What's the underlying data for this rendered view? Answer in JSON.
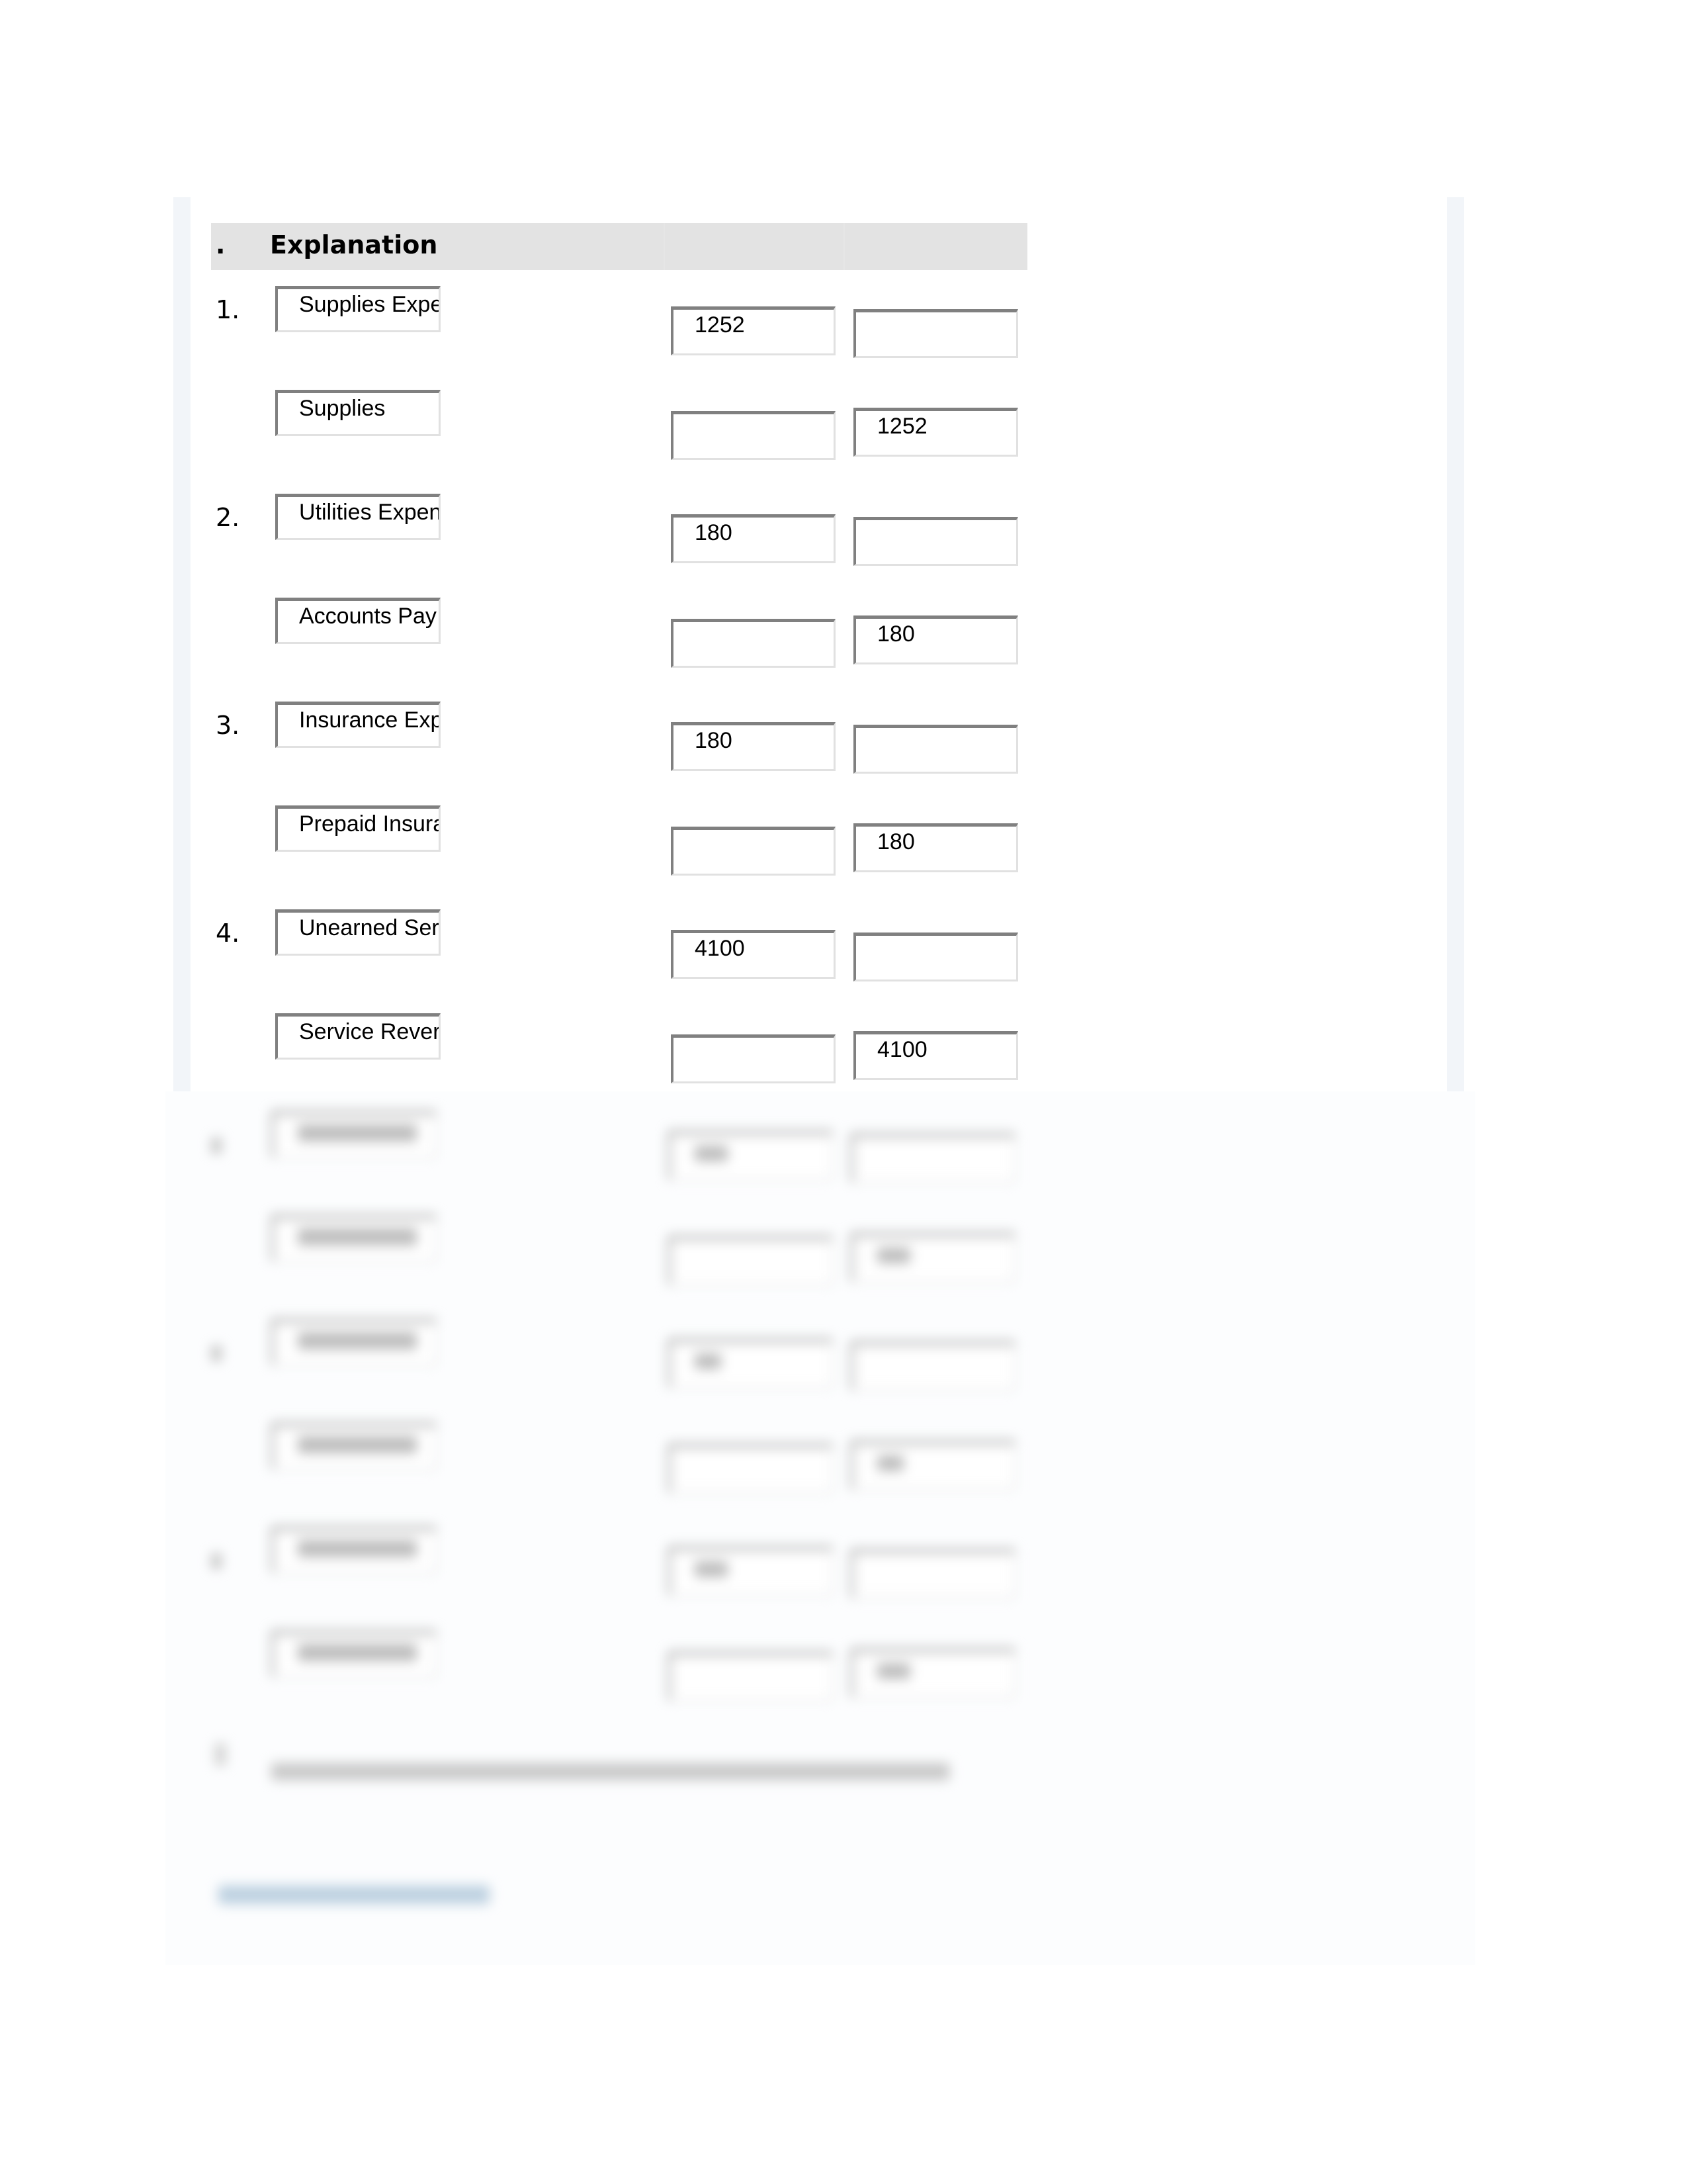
{
  "header": {
    "number_col": ".",
    "explanation_col": "Explanation"
  },
  "entries": [
    {
      "number": "1.",
      "lines": [
        {
          "account": "Supplies Expe",
          "debit": "1252",
          "credit": ""
        },
        {
          "account": "Supplies",
          "debit": "",
          "credit": "1252"
        }
      ]
    },
    {
      "number": "2.",
      "lines": [
        {
          "account": "Utilities Expens",
          "debit": "180",
          "credit": ""
        },
        {
          "account": "Accounts Pay",
          "debit": "",
          "credit": "180"
        }
      ]
    },
    {
      "number": "3.",
      "lines": [
        {
          "account": "Insurance Exp",
          "debit": "180",
          "credit": ""
        },
        {
          "account": "Prepaid Insura",
          "debit": "",
          "credit": "180"
        }
      ]
    },
    {
      "number": "4.",
      "lines": [
        {
          "account": "Unearned Ser",
          "debit": "4100",
          "credit": ""
        },
        {
          "account": "Service Rever",
          "debit": "",
          "credit": "4100"
        }
      ]
    }
  ],
  "colors": {
    "header_bg": "#e3e3e3",
    "panel_strip": "#f2f5f9",
    "field_border_dark": "#808080",
    "field_border_light": "#e1e1e1",
    "link_blurred": "#bcd0e0"
  }
}
